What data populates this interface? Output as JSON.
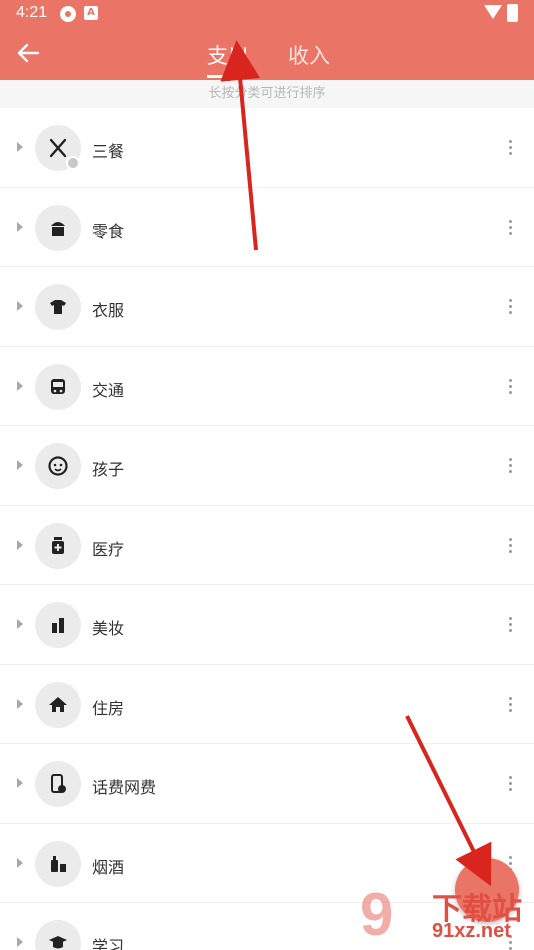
{
  "status_bar": {
    "time": "4:21",
    "app_badge": "A"
  },
  "header": {
    "tabs": [
      {
        "label": "支出"
      },
      {
        "label": "收入"
      }
    ]
  },
  "hint": "长按分类可进行排序",
  "categories": [
    {
      "label": "三餐",
      "icon": "fork-spoon-icon"
    },
    {
      "label": "零食",
      "icon": "cupcake-icon"
    },
    {
      "label": "衣服",
      "icon": "shirt-icon"
    },
    {
      "label": "交通",
      "icon": "bus-icon"
    },
    {
      "label": "孩子",
      "icon": "baby-face-icon"
    },
    {
      "label": "医疗",
      "icon": "medicine-icon"
    },
    {
      "label": "美妆",
      "icon": "lipstick-icon"
    },
    {
      "label": "住房",
      "icon": "home-icon"
    },
    {
      "label": "话费网费",
      "icon": "phone-bill-icon"
    },
    {
      "label": "烟酒",
      "icon": "bottle-icon"
    },
    {
      "label": "学习",
      "icon": "study-icon"
    }
  ],
  "watermark": {
    "site": "下载站",
    "url": "91xz.net"
  },
  "colors": {
    "accent": "#ea7566",
    "arrow": "#d8251d"
  }
}
